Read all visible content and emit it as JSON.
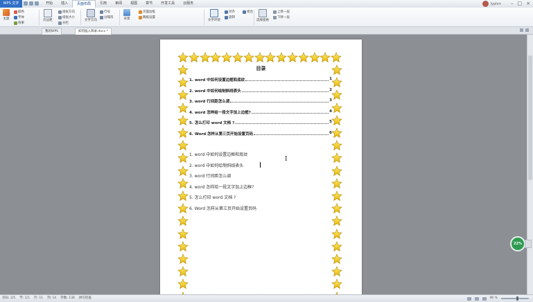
{
  "app": {
    "name": "WPS 文字"
  },
  "menu": [
    "开始",
    "插入",
    "页面布局",
    "引用",
    "审阅",
    "视图",
    "章节",
    "开发工具",
    "云服务"
  ],
  "active_menu_index": 2,
  "user": {
    "name": "lyphm"
  },
  "ribbon": {
    "groups": [
      {
        "big": "主题",
        "small": [
          "颜色",
          "字体",
          "效果"
        ]
      },
      {
        "big": "页边距",
        "small": [
          "纸张方向",
          "纸张大小",
          "分栏"
        ]
      },
      {
        "big": "文字方向",
        "small": [
          "行号",
          "分隔符"
        ]
      },
      {
        "big": "背景",
        "small": [
          "页面边框",
          "稿纸设置"
        ]
      },
      {
        "big": "文字环绕",
        "small": [
          "对齐",
          "旋转",
          "组合"
        ]
      },
      {
        "big": "选择窗格",
        "small": [
          "上移一层",
          "下移一层"
        ]
      }
    ]
  },
  "tabs": [
    "我的WPS",
    "如何插入目录.docx *"
  ],
  "toc": {
    "title": "目录",
    "items": [
      {
        "text": "1. word 中如何设置边框和底纹",
        "page": "1"
      },
      {
        "text": "2. word 中如何绘制斜线表头",
        "page": "2"
      },
      {
        "text": "3. word 行间距怎么调",
        "page": "3"
      },
      {
        "text": "4. word 怎样给一段文字加上边框?",
        "page": "4"
      },
      {
        "text": "5. 怎么打印 word 文档 ?",
        "page": "5"
      },
      {
        "text": "6. Word 怎样从第三页开始设置页码",
        "page": "6"
      }
    ]
  },
  "headings": [
    "1. word 中如何设置边框和底纹",
    "2. word 中如何绘制斜线表头",
    "3. word 行间距怎么调",
    "4. word 怎样给一段文字加上边框?",
    "5. 怎么打印 word 文档 ?",
    "6. Word 怎样从第三页开始设置页码"
  ],
  "status": {
    "page": "页码: 2/5",
    "section": "节: 1/1",
    "row": "行: 11",
    "col": "列: 14",
    "words": "字数: 138",
    "spell": "拼写检查",
    "zoom": "90 %"
  },
  "widget": {
    "label": "22%"
  }
}
